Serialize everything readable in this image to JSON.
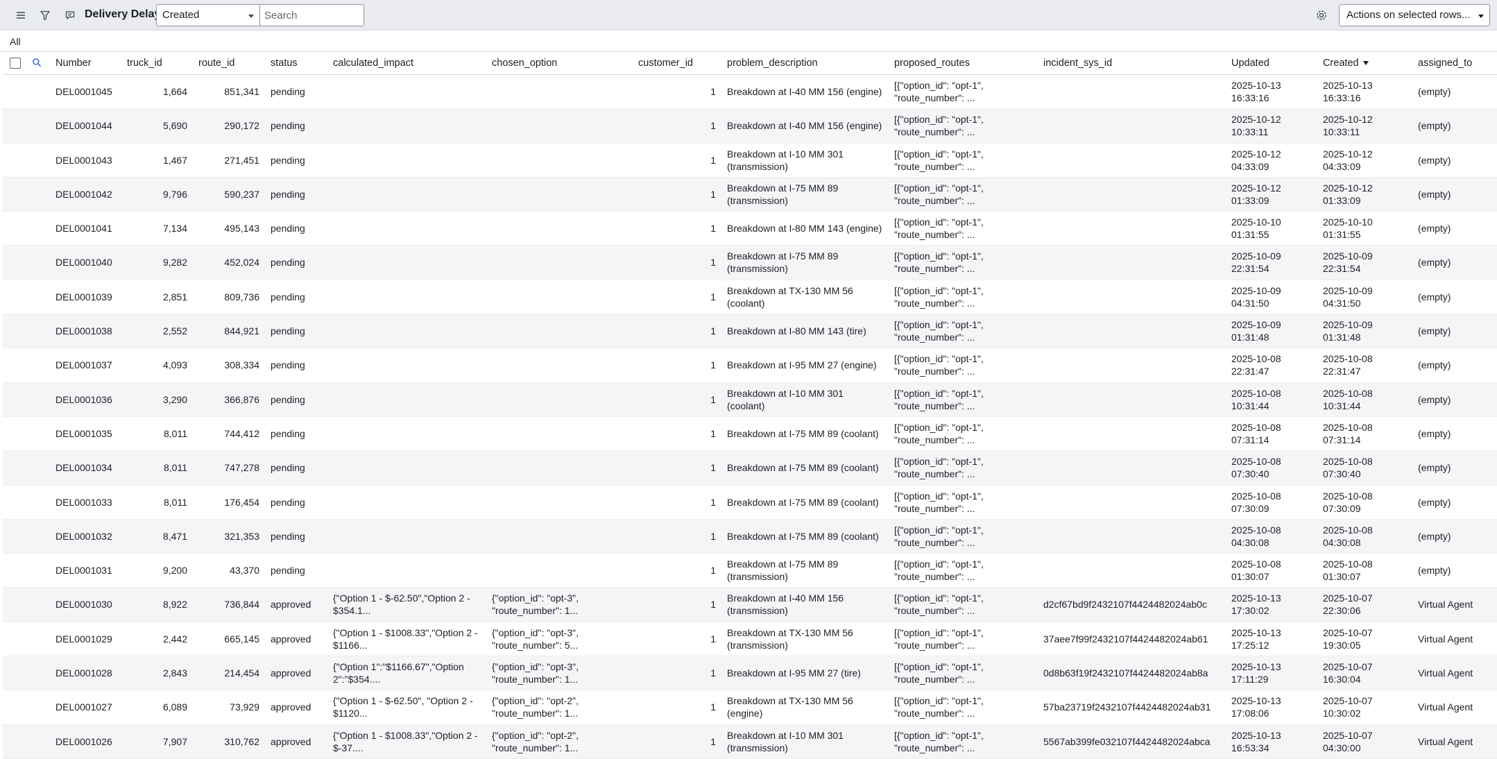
{
  "toolbar": {
    "title": "Delivery Delays",
    "field_select": "Created",
    "search_placeholder": "Search",
    "actions_label": "Actions on selected rows..."
  },
  "breadcrumb": {
    "label": "All"
  },
  "columns": {
    "number": "Number",
    "truck_id": "truck_id",
    "route_id": "route_id",
    "status": "status",
    "calculated_impact": "calculated_impact",
    "chosen_option": "chosen_option",
    "customer_id": "customer_id",
    "problem_description": "problem_description",
    "proposed_routes": "proposed_routes",
    "incident_sys_id": "incident_sys_id",
    "updated": "Updated",
    "created": "Created",
    "assigned_to": "assigned_to"
  },
  "rows": [
    {
      "number": "DEL0001045",
      "truck_id": "1,664",
      "route_id": "851,341",
      "status": "pending",
      "impact": [
        "",
        ""
      ],
      "chosen": [
        "",
        ""
      ],
      "customer_id": "1",
      "problem": [
        "Breakdown at I-40 MM 156 (engine)"
      ],
      "proposed": [
        "[{\"option_id\": \"opt-1\",",
        "\"route_number\": ..."
      ],
      "incident": "",
      "updated": [
        "2025-10-13",
        "16:33:16"
      ],
      "created": [
        "2025-10-13",
        "16:33:16"
      ],
      "assigned": "(empty)",
      "assigned_link": false
    },
    {
      "number": "DEL0001044",
      "truck_id": "5,690",
      "route_id": "290,172",
      "status": "pending",
      "impact": [
        "",
        ""
      ],
      "chosen": [
        "",
        ""
      ],
      "customer_id": "1",
      "problem": [
        "Breakdown at I-40 MM 156 (engine)"
      ],
      "proposed": [
        "[{\"option_id\": \"opt-1\",",
        "\"route_number\": ..."
      ],
      "incident": "",
      "updated": [
        "2025-10-12",
        "10:33:11"
      ],
      "created": [
        "2025-10-12",
        "10:33:11"
      ],
      "assigned": "(empty)",
      "assigned_link": false
    },
    {
      "number": "DEL0001043",
      "truck_id": "1,467",
      "route_id": "271,451",
      "status": "pending",
      "impact": [
        "",
        ""
      ],
      "chosen": [
        "",
        ""
      ],
      "customer_id": "1",
      "problem": [
        "Breakdown at I-10 MM 301",
        "(transmission)"
      ],
      "proposed": [
        "[{\"option_id\": \"opt-1\",",
        "\"route_number\": ..."
      ],
      "incident": "",
      "updated": [
        "2025-10-12",
        "04:33:09"
      ],
      "created": [
        "2025-10-12",
        "04:33:09"
      ],
      "assigned": "(empty)",
      "assigned_link": false
    },
    {
      "number": "DEL0001042",
      "truck_id": "9,796",
      "route_id": "590,237",
      "status": "pending",
      "impact": [
        "",
        ""
      ],
      "chosen": [
        "",
        ""
      ],
      "customer_id": "1",
      "problem": [
        "Breakdown at I-75 MM 89",
        "(transmission)"
      ],
      "proposed": [
        "[{\"option_id\": \"opt-1\",",
        "\"route_number\": ..."
      ],
      "incident": "",
      "updated": [
        "2025-10-12",
        "01:33:09"
      ],
      "created": [
        "2025-10-12",
        "01:33:09"
      ],
      "assigned": "(empty)",
      "assigned_link": false
    },
    {
      "number": "DEL0001041",
      "truck_id": "7,134",
      "route_id": "495,143",
      "status": "pending",
      "impact": [
        "",
        ""
      ],
      "chosen": [
        "",
        ""
      ],
      "customer_id": "1",
      "problem": [
        "Breakdown at I-80 MM 143 (engine)"
      ],
      "proposed": [
        "[{\"option_id\": \"opt-1\",",
        "\"route_number\": ..."
      ],
      "incident": "",
      "updated": [
        "2025-10-10",
        "01:31:55"
      ],
      "created": [
        "2025-10-10",
        "01:31:55"
      ],
      "assigned": "(empty)",
      "assigned_link": false
    },
    {
      "number": "DEL0001040",
      "truck_id": "9,282",
      "route_id": "452,024",
      "status": "pending",
      "impact": [
        "",
        ""
      ],
      "chosen": [
        "",
        ""
      ],
      "customer_id": "1",
      "problem": [
        "Breakdown at I-75 MM 89",
        "(transmission)"
      ],
      "proposed": [
        "[{\"option_id\": \"opt-1\",",
        "\"route_number\": ..."
      ],
      "incident": "",
      "updated": [
        "2025-10-09",
        "22:31:54"
      ],
      "created": [
        "2025-10-09",
        "22:31:54"
      ],
      "assigned": "(empty)",
      "assigned_link": false
    },
    {
      "number": "DEL0001039",
      "truck_id": "2,851",
      "route_id": "809,736",
      "status": "pending",
      "impact": [
        "",
        ""
      ],
      "chosen": [
        "",
        ""
      ],
      "customer_id": "1",
      "problem": [
        "Breakdown at TX-130 MM 56",
        "(coolant)"
      ],
      "proposed": [
        "[{\"option_id\": \"opt-1\",",
        "\"route_number\": ..."
      ],
      "incident": "",
      "updated": [
        "2025-10-09",
        "04:31:50"
      ],
      "created": [
        "2025-10-09",
        "04:31:50"
      ],
      "assigned": "(empty)",
      "assigned_link": false
    },
    {
      "number": "DEL0001038",
      "truck_id": "2,552",
      "route_id": "844,921",
      "status": "pending",
      "impact": [
        "",
        ""
      ],
      "chosen": [
        "",
        ""
      ],
      "customer_id": "1",
      "problem": [
        "Breakdown at I-80 MM 143 (tire)"
      ],
      "proposed": [
        "[{\"option_id\": \"opt-1\",",
        "\"route_number\": ..."
      ],
      "incident": "",
      "updated": [
        "2025-10-09",
        "01:31:48"
      ],
      "created": [
        "2025-10-09",
        "01:31:48"
      ],
      "assigned": "(empty)",
      "assigned_link": false
    },
    {
      "number": "DEL0001037",
      "truck_id": "4,093",
      "route_id": "308,334",
      "status": "pending",
      "impact": [
        "",
        ""
      ],
      "chosen": [
        "",
        ""
      ],
      "customer_id": "1",
      "problem": [
        "Breakdown at I-95 MM 27 (engine)"
      ],
      "proposed": [
        "[{\"option_id\": \"opt-1\",",
        "\"route_number\": ..."
      ],
      "incident": "",
      "updated": [
        "2025-10-08",
        "22:31:47"
      ],
      "created": [
        "2025-10-08",
        "22:31:47"
      ],
      "assigned": "(empty)",
      "assigned_link": false
    },
    {
      "number": "DEL0001036",
      "truck_id": "3,290",
      "route_id": "366,876",
      "status": "pending",
      "impact": [
        "",
        ""
      ],
      "chosen": [
        "",
        ""
      ],
      "customer_id": "1",
      "problem": [
        "Breakdown at I-10 MM 301",
        "(coolant)"
      ],
      "proposed": [
        "[{\"option_id\": \"opt-1\",",
        "\"route_number\": ..."
      ],
      "incident": "",
      "updated": [
        "2025-10-08",
        "10:31:44"
      ],
      "created": [
        "2025-10-08",
        "10:31:44"
      ],
      "assigned": "(empty)",
      "assigned_link": false
    },
    {
      "number": "DEL0001035",
      "truck_id": "8,011",
      "route_id": "744,412",
      "status": "pending",
      "impact": [
        "",
        ""
      ],
      "chosen": [
        "",
        ""
      ],
      "customer_id": "1",
      "problem": [
        "Breakdown at I-75 MM 89 (coolant)"
      ],
      "proposed": [
        "[{\"option_id\": \"opt-1\",",
        "\"route_number\": ..."
      ],
      "incident": "",
      "updated": [
        "2025-10-08",
        "07:31:14"
      ],
      "created": [
        "2025-10-08",
        "07:31:14"
      ],
      "assigned": "(empty)",
      "assigned_link": false
    },
    {
      "number": "DEL0001034",
      "truck_id": "8,011",
      "route_id": "747,278",
      "status": "pending",
      "impact": [
        "",
        ""
      ],
      "chosen": [
        "",
        ""
      ],
      "customer_id": "1",
      "problem": [
        "Breakdown at I-75 MM 89 (coolant)"
      ],
      "proposed": [
        "[{\"option_id\": \"opt-1\",",
        "\"route_number\": ..."
      ],
      "incident": "",
      "updated": [
        "2025-10-08",
        "07:30:40"
      ],
      "created": [
        "2025-10-08",
        "07:30:40"
      ],
      "assigned": "(empty)",
      "assigned_link": false
    },
    {
      "number": "DEL0001033",
      "truck_id": "8,011",
      "route_id": "176,454",
      "status": "pending",
      "impact": [
        "",
        ""
      ],
      "chosen": [
        "",
        ""
      ],
      "customer_id": "1",
      "problem": [
        "Breakdown at I-75 MM 89 (coolant)"
      ],
      "proposed": [
        "[{\"option_id\": \"opt-1\",",
        "\"route_number\": ..."
      ],
      "incident": "",
      "updated": [
        "2025-10-08",
        "07:30:09"
      ],
      "created": [
        "2025-10-08",
        "07:30:09"
      ],
      "assigned": "(empty)",
      "assigned_link": false
    },
    {
      "number": "DEL0001032",
      "truck_id": "8,471",
      "route_id": "321,353",
      "status": "pending",
      "impact": [
        "",
        ""
      ],
      "chosen": [
        "",
        ""
      ],
      "customer_id": "1",
      "problem": [
        "Breakdown at I-75 MM 89 (coolant)"
      ],
      "proposed": [
        "[{\"option_id\": \"opt-1\",",
        "\"route_number\": ..."
      ],
      "incident": "",
      "updated": [
        "2025-10-08",
        "04:30:08"
      ],
      "created": [
        "2025-10-08",
        "04:30:08"
      ],
      "assigned": "(empty)",
      "assigned_link": false
    },
    {
      "number": "DEL0001031",
      "truck_id": "9,200",
      "route_id": "43,370",
      "status": "pending",
      "impact": [
        "",
        ""
      ],
      "chosen": [
        "",
        ""
      ],
      "customer_id": "1",
      "problem": [
        "Breakdown at I-75 MM 89",
        "(transmission)"
      ],
      "proposed": [
        "[{\"option_id\": \"opt-1\",",
        "\"route_number\": ..."
      ],
      "incident": "",
      "updated": [
        "2025-10-08",
        "01:30:07"
      ],
      "created": [
        "2025-10-08",
        "01:30:07"
      ],
      "assigned": "(empty)",
      "assigned_link": false
    },
    {
      "number": "DEL0001030",
      "truck_id": "8,922",
      "route_id": "736,844",
      "status": "approved",
      "impact": [
        "{\"Option 1 - $-62.50\",\"Option 2 -",
        "$354.1..."
      ],
      "chosen": [
        "{\"option_id\": \"opt-3\",",
        "\"route_number\": 1..."
      ],
      "customer_id": "1",
      "problem": [
        "Breakdown at I-40 MM 156",
        "(transmission)"
      ],
      "proposed": [
        "[{\"option_id\": \"opt-1\",",
        "\"route_number\": ..."
      ],
      "incident": "d2cf67bd9f2432107f4424482024ab0c",
      "updated": [
        "2025-10-13",
        "17:30:02"
      ],
      "created": [
        "2025-10-07",
        "22:30:06"
      ],
      "assigned": "Virtual Agent",
      "assigned_link": true
    },
    {
      "number": "DEL0001029",
      "truck_id": "2,442",
      "route_id": "665,145",
      "status": "approved",
      "impact": [
        "{\"Option 1 - $1008.33\",\"Option 2 -",
        "$1166..."
      ],
      "chosen": [
        "{\"option_id\": \"opt-3\",",
        "\"route_number\": 5..."
      ],
      "customer_id": "1",
      "problem": [
        "Breakdown at TX-130 MM 56",
        "(transmission)"
      ],
      "proposed": [
        "[{\"option_id\": \"opt-1\",",
        "\"route_number\": ..."
      ],
      "incident": "37aee7f99f2432107f4424482024ab61",
      "updated": [
        "2025-10-13",
        "17:25:12"
      ],
      "created": [
        "2025-10-07",
        "19:30:05"
      ],
      "assigned": "Virtual Agent",
      "assigned_link": true
    },
    {
      "number": "DEL0001028",
      "truck_id": "2,843",
      "route_id": "214,454",
      "status": "approved",
      "impact": [
        "{\"Option 1\":\"$1166.67\",\"Option",
        "2\":\"$354...."
      ],
      "chosen": [
        "{\"option_id\": \"opt-3\",",
        "\"route_number\": 1..."
      ],
      "customer_id": "1",
      "problem": [
        "Breakdown at I-95 MM 27 (tire)"
      ],
      "proposed": [
        "[{\"option_id\": \"opt-1\",",
        "\"route_number\": ..."
      ],
      "incident": "0d8b63f19f2432107f4424482024ab8a",
      "updated": [
        "2025-10-13",
        "17:11:29"
      ],
      "created": [
        "2025-10-07",
        "16:30:04"
      ],
      "assigned": "Virtual Agent",
      "assigned_link": true
    },
    {
      "number": "DEL0001027",
      "truck_id": "6,089",
      "route_id": "73,929",
      "status": "approved",
      "impact": [
        "{\"Option 1 - $-62.50\", \"Option 2 -",
        "$1120..."
      ],
      "chosen": [
        "{\"option_id\": \"opt-2\",",
        "\"route_number\": 1..."
      ],
      "customer_id": "1",
      "problem": [
        "Breakdown at TX-130 MM 56",
        "(engine)"
      ],
      "proposed": [
        "[{\"option_id\": \"opt-1\",",
        "\"route_number\": ..."
      ],
      "incident": "57ba23719f2432107f4424482024ab31",
      "updated": [
        "2025-10-13",
        "17:08:06"
      ],
      "created": [
        "2025-10-07",
        "10:30:02"
      ],
      "assigned": "Virtual Agent",
      "assigned_link": true
    },
    {
      "number": "DEL0001026",
      "truck_id": "7,907",
      "route_id": "310,762",
      "status": "approved",
      "impact": [
        "{\"Option 1 - $1008.33\",\"Option 2 -",
        "$-37...."
      ],
      "chosen": [
        "{\"option_id\": \"opt-2\",",
        "\"route_number\": 1..."
      ],
      "customer_id": "1",
      "problem": [
        "Breakdown at I-10 MM 301",
        "(transmission)"
      ],
      "proposed": [
        "[{\"option_id\": \"opt-1\",",
        "\"route_number\": ..."
      ],
      "incident": "5567ab399fe032107f4424482024abca",
      "updated": [
        "2025-10-13",
        "16:53:34"
      ],
      "created": [
        "2025-10-07",
        "04:30:00"
      ],
      "assigned": "Virtual Agent",
      "assigned_link": true
    }
  ]
}
